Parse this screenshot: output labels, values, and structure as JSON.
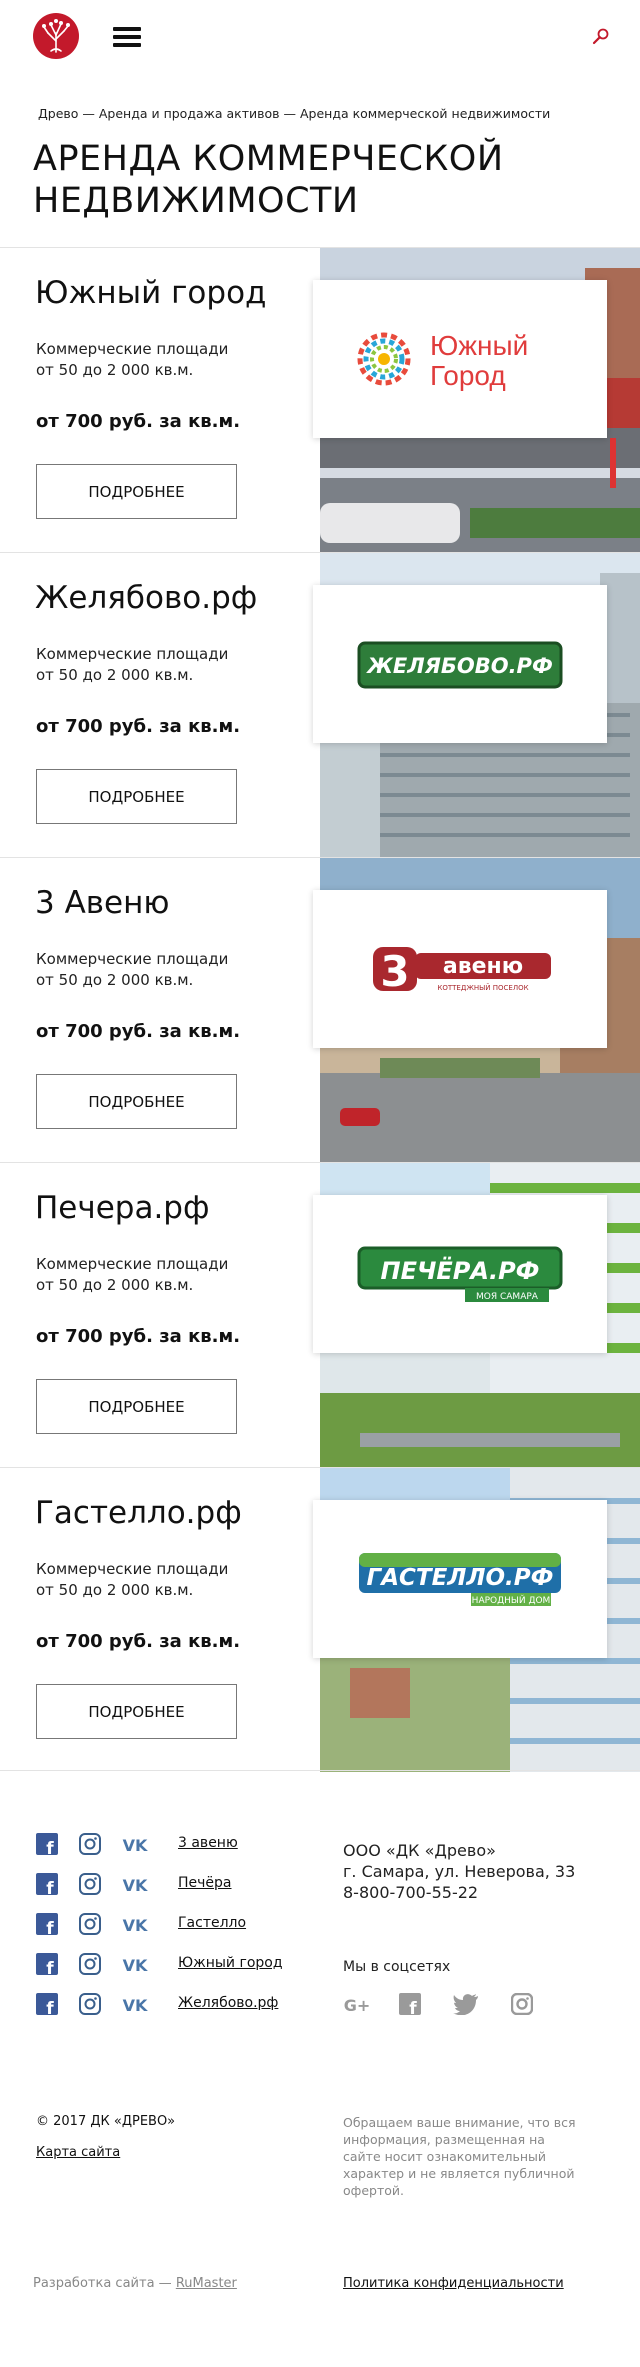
{
  "header": {
    "logo_icon": "tree-logo",
    "menu_icon": "hamburger-icon",
    "search_icon": "search-icon"
  },
  "breadcrumb": {
    "text": "Древо — Аренда и продажа активов — Аренда коммерческой недвижимости"
  },
  "page_title": "Аренда коммерческой недвижимости",
  "projects": [
    {
      "title": "Южный город",
      "desc1": "Коммерческие площади",
      "desc2": "от 50 до 2 000 кв.м.",
      "price": "от 700 руб. за кв.м.",
      "button": "ПОДРОБНЕЕ",
      "logo_line1": "Южный",
      "logo_line2": "Город"
    },
    {
      "title": "Желябово.рф",
      "desc1": "Коммерческие площади",
      "desc2": "от 50 до 2 000 кв.м.",
      "price": "от 700 руб. за кв.м.",
      "button": "ПОДРОБНЕЕ",
      "logo_line1": "ЖЕЛЯБОВО.РФ",
      "logo_line2": ""
    },
    {
      "title": "3 Авеню",
      "desc1": "Коммерческие площади",
      "desc2": "от 50 до 2 000 кв.м.",
      "price": "от 700 руб. за кв.м.",
      "button": "ПОДРОБНЕЕ",
      "logo_line1": "авеню",
      "logo_line2": "КОТТЕДЖНЫЙ ПОСЕЛОК"
    },
    {
      "title": "Печера.рф",
      "desc1": "Коммерческие площади",
      "desc2": "от 50 до 2 000 кв.м.",
      "price": "от 700 руб. за кв.м.",
      "button": "ПОДРОБНЕЕ",
      "logo_line1": "ПЕЧЁРА.РФ",
      "logo_line2": "МОЯ САМАРА"
    },
    {
      "title": "Гастелло.рф",
      "desc1": "Коммерческие площади",
      "desc2": "от 50 до 2 000 кв.м.",
      "price": "от 700 руб. за кв.м.",
      "button": "ПОДРОБНЕЕ",
      "logo_line1": "ГАСТЕЛЛО.РФ",
      "logo_line2": "НАРОДНЫЙ ДОМ"
    }
  ],
  "footer": {
    "social_links": [
      "3 авеню",
      "Печёра",
      "Гастелло",
      "Южный город",
      "Желябово.рф"
    ],
    "company_name": "ООО «ДК «Древо»",
    "address": "г. Самара, ул. Неверова, 33",
    "phone": "8-800-700-55-22",
    "social_heading": "Мы в соцсетях",
    "copyright": "© 2017 ДК «ДРЕВО»",
    "sitemap": "Карта сайта",
    "notice": "Обращаем ваше внимание, что вся информация, размещенная на сайте носит ознакомительный характер и не является публичной офертой.",
    "dev_prefix": "Разработка сайта —",
    "dev_link": "RuMaster",
    "privacy": "Политика конфиденциальности"
  },
  "colors": {
    "brand_red": "#c3192b",
    "facebook": "#3b5998",
    "vk": "#4a76a8",
    "muted": "#888888"
  }
}
